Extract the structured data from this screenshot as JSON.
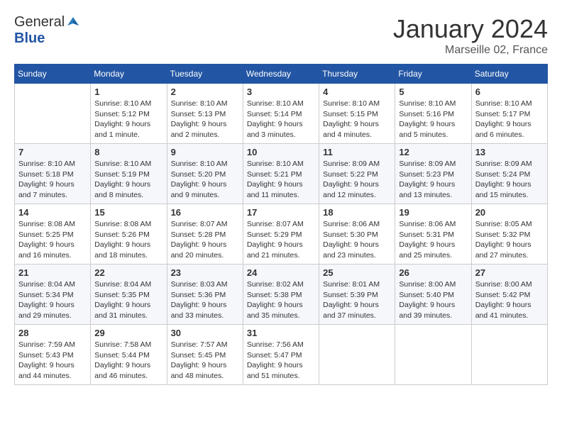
{
  "header": {
    "logo_general": "General",
    "logo_blue": "Blue",
    "month_year": "January 2024",
    "location": "Marseille 02, France"
  },
  "calendar": {
    "days_of_week": [
      "Sunday",
      "Monday",
      "Tuesday",
      "Wednesday",
      "Thursday",
      "Friday",
      "Saturday"
    ],
    "weeks": [
      [
        {
          "day": "",
          "info": ""
        },
        {
          "day": "1",
          "info": "Sunrise: 8:10 AM\nSunset: 5:12 PM\nDaylight: 9 hours\nand 1 minute."
        },
        {
          "day": "2",
          "info": "Sunrise: 8:10 AM\nSunset: 5:13 PM\nDaylight: 9 hours\nand 2 minutes."
        },
        {
          "day": "3",
          "info": "Sunrise: 8:10 AM\nSunset: 5:14 PM\nDaylight: 9 hours\nand 3 minutes."
        },
        {
          "day": "4",
          "info": "Sunrise: 8:10 AM\nSunset: 5:15 PM\nDaylight: 9 hours\nand 4 minutes."
        },
        {
          "day": "5",
          "info": "Sunrise: 8:10 AM\nSunset: 5:16 PM\nDaylight: 9 hours\nand 5 minutes."
        },
        {
          "day": "6",
          "info": "Sunrise: 8:10 AM\nSunset: 5:17 PM\nDaylight: 9 hours\nand 6 minutes."
        }
      ],
      [
        {
          "day": "7",
          "info": "Sunrise: 8:10 AM\nSunset: 5:18 PM\nDaylight: 9 hours\nand 7 minutes."
        },
        {
          "day": "8",
          "info": "Sunrise: 8:10 AM\nSunset: 5:19 PM\nDaylight: 9 hours\nand 8 minutes."
        },
        {
          "day": "9",
          "info": "Sunrise: 8:10 AM\nSunset: 5:20 PM\nDaylight: 9 hours\nand 9 minutes."
        },
        {
          "day": "10",
          "info": "Sunrise: 8:10 AM\nSunset: 5:21 PM\nDaylight: 9 hours\nand 11 minutes."
        },
        {
          "day": "11",
          "info": "Sunrise: 8:09 AM\nSunset: 5:22 PM\nDaylight: 9 hours\nand 12 minutes."
        },
        {
          "day": "12",
          "info": "Sunrise: 8:09 AM\nSunset: 5:23 PM\nDaylight: 9 hours\nand 13 minutes."
        },
        {
          "day": "13",
          "info": "Sunrise: 8:09 AM\nSunset: 5:24 PM\nDaylight: 9 hours\nand 15 minutes."
        }
      ],
      [
        {
          "day": "14",
          "info": "Sunrise: 8:08 AM\nSunset: 5:25 PM\nDaylight: 9 hours\nand 16 minutes."
        },
        {
          "day": "15",
          "info": "Sunrise: 8:08 AM\nSunset: 5:26 PM\nDaylight: 9 hours\nand 18 minutes."
        },
        {
          "day": "16",
          "info": "Sunrise: 8:07 AM\nSunset: 5:28 PM\nDaylight: 9 hours\nand 20 minutes."
        },
        {
          "day": "17",
          "info": "Sunrise: 8:07 AM\nSunset: 5:29 PM\nDaylight: 9 hours\nand 21 minutes."
        },
        {
          "day": "18",
          "info": "Sunrise: 8:06 AM\nSunset: 5:30 PM\nDaylight: 9 hours\nand 23 minutes."
        },
        {
          "day": "19",
          "info": "Sunrise: 8:06 AM\nSunset: 5:31 PM\nDaylight: 9 hours\nand 25 minutes."
        },
        {
          "day": "20",
          "info": "Sunrise: 8:05 AM\nSunset: 5:32 PM\nDaylight: 9 hours\nand 27 minutes."
        }
      ],
      [
        {
          "day": "21",
          "info": "Sunrise: 8:04 AM\nSunset: 5:34 PM\nDaylight: 9 hours\nand 29 minutes."
        },
        {
          "day": "22",
          "info": "Sunrise: 8:04 AM\nSunset: 5:35 PM\nDaylight: 9 hours\nand 31 minutes."
        },
        {
          "day": "23",
          "info": "Sunrise: 8:03 AM\nSunset: 5:36 PM\nDaylight: 9 hours\nand 33 minutes."
        },
        {
          "day": "24",
          "info": "Sunrise: 8:02 AM\nSunset: 5:38 PM\nDaylight: 9 hours\nand 35 minutes."
        },
        {
          "day": "25",
          "info": "Sunrise: 8:01 AM\nSunset: 5:39 PM\nDaylight: 9 hours\nand 37 minutes."
        },
        {
          "day": "26",
          "info": "Sunrise: 8:00 AM\nSunset: 5:40 PM\nDaylight: 9 hours\nand 39 minutes."
        },
        {
          "day": "27",
          "info": "Sunrise: 8:00 AM\nSunset: 5:42 PM\nDaylight: 9 hours\nand 41 minutes."
        }
      ],
      [
        {
          "day": "28",
          "info": "Sunrise: 7:59 AM\nSunset: 5:43 PM\nDaylight: 9 hours\nand 44 minutes."
        },
        {
          "day": "29",
          "info": "Sunrise: 7:58 AM\nSunset: 5:44 PM\nDaylight: 9 hours\nand 46 minutes."
        },
        {
          "day": "30",
          "info": "Sunrise: 7:57 AM\nSunset: 5:45 PM\nDaylight: 9 hours\nand 48 minutes."
        },
        {
          "day": "31",
          "info": "Sunrise: 7:56 AM\nSunset: 5:47 PM\nDaylight: 9 hours\nand 51 minutes."
        },
        {
          "day": "",
          "info": ""
        },
        {
          "day": "",
          "info": ""
        },
        {
          "day": "",
          "info": ""
        }
      ]
    ]
  }
}
